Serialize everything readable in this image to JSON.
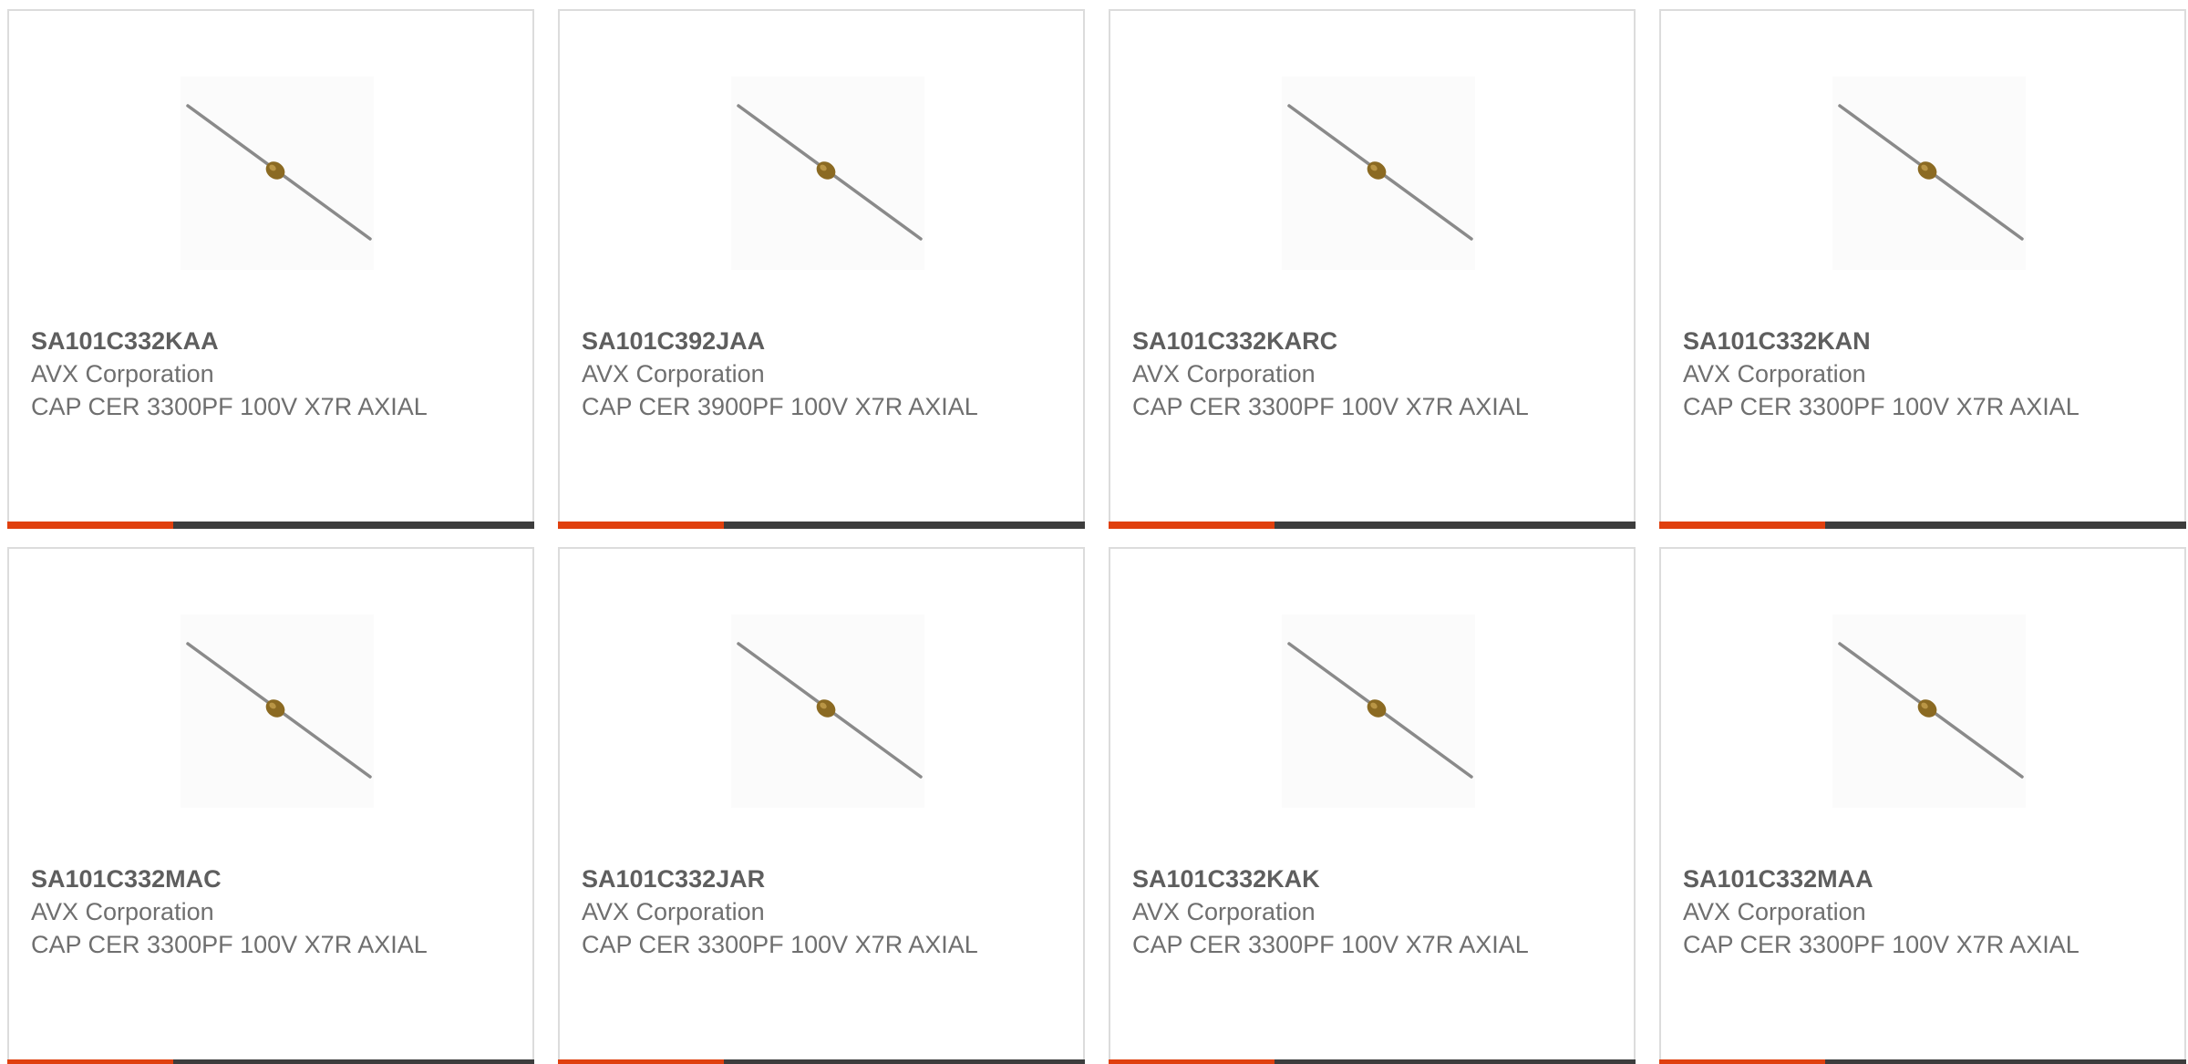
{
  "theme": {
    "accent": "#e0400e",
    "bar_dark": "#3d3d3d",
    "border": "#dcdcdc",
    "text": "#6f6f6f"
  },
  "products": [
    {
      "part_number": "SA101C332KAA",
      "manufacturer": "AVX Corporation",
      "description": "CAP CER 3300PF 100V X7R AXIAL",
      "image_icon": "axial-capacitor-icon"
    },
    {
      "part_number": "SA101C392JAA",
      "manufacturer": "AVX Corporation",
      "description": "CAP CER 3900PF 100V X7R AXIAL",
      "image_icon": "axial-capacitor-icon"
    },
    {
      "part_number": "SA101C332KARC",
      "manufacturer": "AVX Corporation",
      "description": "CAP CER 3300PF 100V X7R AXIAL",
      "image_icon": "axial-capacitor-icon"
    },
    {
      "part_number": "SA101C332KAN",
      "manufacturer": "AVX Corporation",
      "description": "CAP CER 3300PF 100V X7R AXIAL",
      "image_icon": "axial-capacitor-icon"
    },
    {
      "part_number": "SA101C332MAC",
      "manufacturer": "AVX Corporation",
      "description": "CAP CER 3300PF 100V X7R AXIAL",
      "image_icon": "axial-capacitor-icon"
    },
    {
      "part_number": "SA101C332JAR",
      "manufacturer": "AVX Corporation",
      "description": "CAP CER 3300PF 100V X7R AXIAL",
      "image_icon": "axial-capacitor-icon"
    },
    {
      "part_number": "SA101C332KAK",
      "manufacturer": "AVX Corporation",
      "description": "CAP CER 3300PF 100V X7R AXIAL",
      "image_icon": "axial-capacitor-icon"
    },
    {
      "part_number": "SA101C332MAA",
      "manufacturer": "AVX Corporation",
      "description": "CAP CER 3300PF 100V X7R AXIAL",
      "image_icon": "axial-capacitor-icon"
    }
  ]
}
